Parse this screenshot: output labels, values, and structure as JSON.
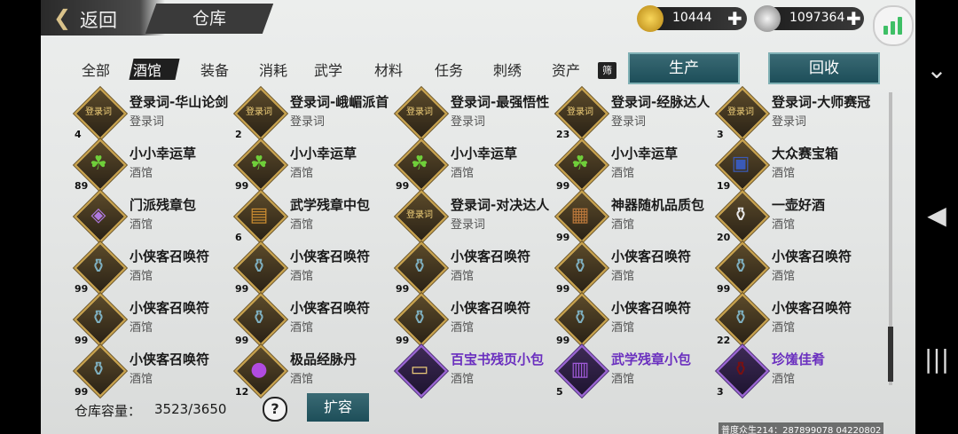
{
  "header": {
    "back_label": "返回",
    "title": "仓库"
  },
  "currencies": [
    {
      "icon": "gold-ingot-icon",
      "value": "10444",
      "plus": "✚"
    },
    {
      "icon": "silver-ingot-icon",
      "value": "1097364",
      "plus": "✚"
    }
  ],
  "tabs": [
    "全部",
    "酒馆",
    "装备",
    "消耗",
    "武学",
    "材料",
    "任务",
    "刺绣",
    "资产"
  ],
  "active_tab": "酒馆",
  "filter_label": "筛",
  "buttons": {
    "produce": "生产",
    "recycle": "回收",
    "expand": "扩容",
    "help": "?"
  },
  "items": [
    {
      "name": "登录词-华山论剑",
      "type": "登录词",
      "qty": "4",
      "icon": "scroll-plaque-icon"
    },
    {
      "name": "登录词-峨嵋派首",
      "type": "登录词",
      "qty": "2",
      "icon": "scroll-plaque-icon"
    },
    {
      "name": "登录词-最强悟性",
      "type": "登录词",
      "qty": "",
      "icon": "scroll-plaque-icon"
    },
    {
      "name": "登录词-经脉达人",
      "type": "登录词",
      "qty": "23",
      "icon": "scroll-plaque-icon"
    },
    {
      "name": "登录词-大师赛冠",
      "type": "登录词",
      "qty": "3",
      "icon": "scroll-plaque-icon"
    },
    {
      "name": "小小幸运草",
      "type": "酒馆",
      "qty": "89",
      "icon": "clover-icon"
    },
    {
      "name": "小小幸运草",
      "type": "酒馆",
      "qty": "99",
      "icon": "clover-icon"
    },
    {
      "name": "小小幸运草",
      "type": "酒馆",
      "qty": "99",
      "icon": "clover-icon"
    },
    {
      "name": "小小幸运草",
      "type": "酒馆",
      "qty": "99",
      "icon": "clover-icon"
    },
    {
      "name": "大众赛宝箱",
      "type": "酒馆",
      "qty": "19",
      "icon": "treasure-chest-icon"
    },
    {
      "name": "门派残章包",
      "type": "酒馆",
      "qty": "",
      "icon": "gift-box-icon"
    },
    {
      "name": "武学残章中包",
      "type": "酒馆",
      "qty": "6",
      "icon": "book-icon"
    },
    {
      "name": "登录词-对决达人",
      "type": "登录词",
      "qty": "",
      "icon": "scroll-plaque-icon"
    },
    {
      "name": "神器随机品质包",
      "type": "酒馆",
      "qty": "99",
      "icon": "wooden-chest-icon"
    },
    {
      "name": "一壶好酒",
      "type": "酒馆",
      "qty": "20",
      "icon": "wine-jar-icon"
    },
    {
      "name": "小侠客召唤符",
      "type": "酒馆",
      "qty": "99",
      "icon": "summon-pot-icon"
    },
    {
      "name": "小侠客召唤符",
      "type": "酒馆",
      "qty": "99",
      "icon": "summon-pot-icon"
    },
    {
      "name": "小侠客召唤符",
      "type": "酒馆",
      "qty": "99",
      "icon": "summon-pot-icon"
    },
    {
      "name": "小侠客召唤符",
      "type": "酒馆",
      "qty": "99",
      "icon": "summon-pot-icon"
    },
    {
      "name": "小侠客召唤符",
      "type": "酒馆",
      "qty": "99",
      "icon": "summon-pot-icon"
    },
    {
      "name": "小侠客召唤符",
      "type": "酒馆",
      "qty": "99",
      "icon": "summon-pot-icon"
    },
    {
      "name": "小侠客召唤符",
      "type": "酒馆",
      "qty": "99",
      "icon": "summon-pot-icon"
    },
    {
      "name": "小侠客召唤符",
      "type": "酒馆",
      "qty": "99",
      "icon": "summon-pot-icon"
    },
    {
      "name": "小侠客召唤符",
      "type": "酒馆",
      "qty": "99",
      "icon": "summon-pot-icon"
    },
    {
      "name": "小侠客召唤符",
      "type": "酒馆",
      "qty": "22",
      "icon": "summon-pot-icon"
    },
    {
      "name": "小侠客召唤符",
      "type": "酒馆",
      "qty": "99",
      "icon": "summon-pot-icon"
    },
    {
      "name": "极品经脉丹",
      "type": "酒馆",
      "qty": "12",
      "icon": "purple-pill-icon"
    },
    {
      "name": "百宝书残页小包",
      "type": "酒馆",
      "qty": "",
      "icon": "scroll-page-icon",
      "rarity": "purple"
    },
    {
      "name": "武学残章小包",
      "type": "酒馆",
      "qty": "5",
      "icon": "purple-book-icon",
      "rarity": "purple"
    },
    {
      "name": "珍馐佳肴",
      "type": "酒馆",
      "qty": "3",
      "icon": "food-jar-icon",
      "rarity": "purple"
    }
  ],
  "footer": {
    "capacity_label": "仓库容量：",
    "capacity_value": "3523/3650"
  },
  "watermark": "普度众生214：287899078  04220802"
}
